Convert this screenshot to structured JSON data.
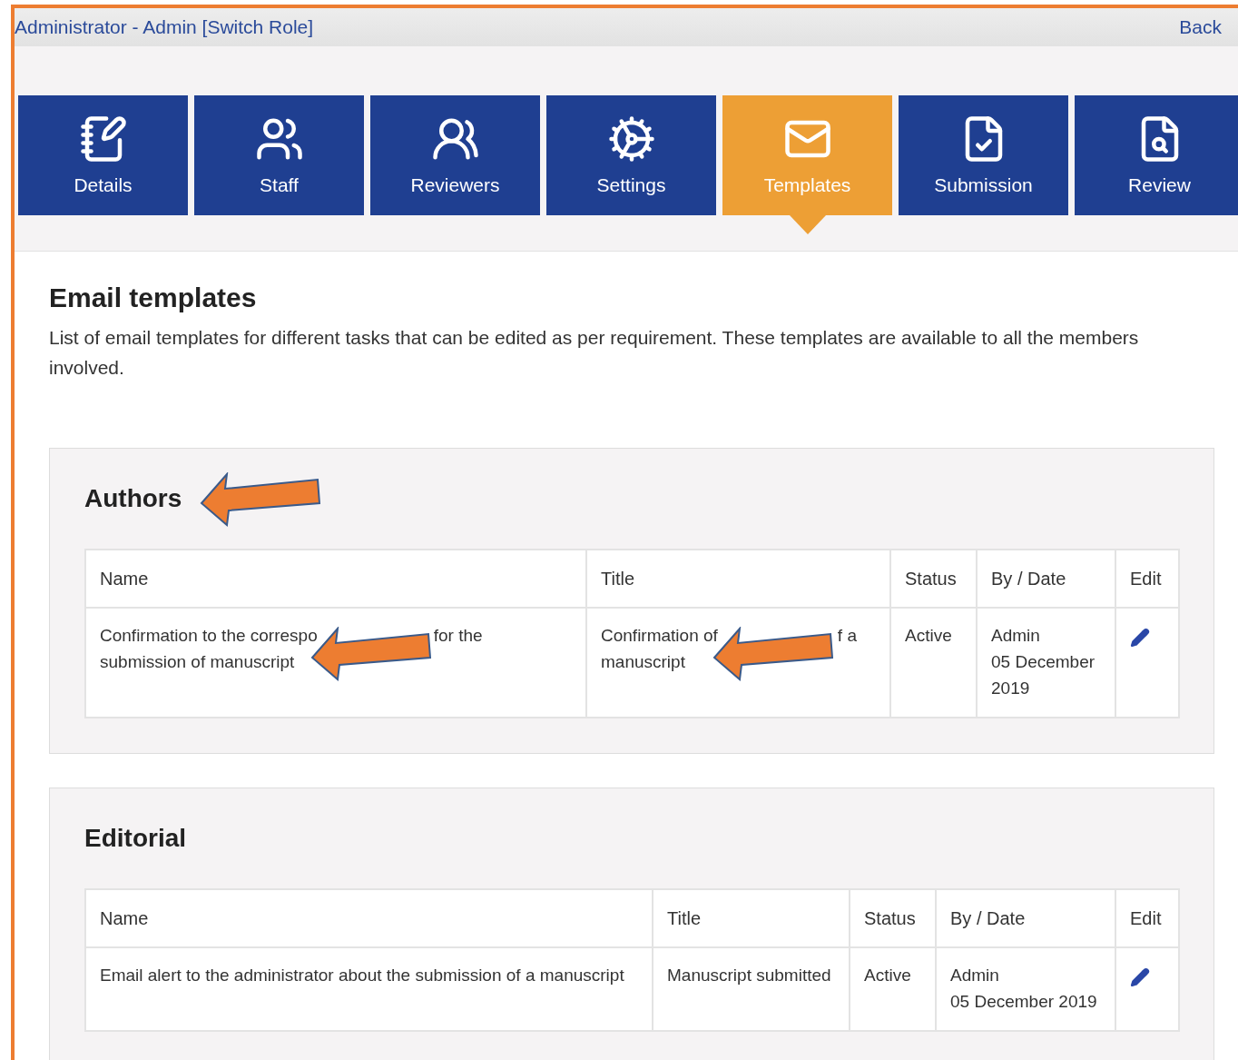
{
  "header": {
    "role_text": "Administrator - Admin [Switch Role]",
    "back_link": "Back"
  },
  "tabs": [
    {
      "label": "Details",
      "selected": false
    },
    {
      "label": "Staff",
      "selected": false
    },
    {
      "label": "Reviewers",
      "selected": false
    },
    {
      "label": "Settings",
      "selected": false
    },
    {
      "label": "Templates",
      "selected": true
    },
    {
      "label": "Submission",
      "selected": false
    },
    {
      "label": "Review",
      "selected": false
    }
  ],
  "page": {
    "title": "Email templates",
    "description": "List of email templates for different tasks that can be edited as per requirement. These templates are available to all the members involved."
  },
  "sections": [
    {
      "title": "Authors",
      "columns": [
        "Name",
        "Title",
        "Status",
        "By / Date",
        "Edit"
      ],
      "rows": [
        {
          "name_parts": [
            "Confirmation to the correspo",
            "for the",
            "submission of manuscript"
          ],
          "title_parts": [
            "Confirmation of",
            "f a",
            "manuscript"
          ],
          "status": "Active",
          "by": "Admin",
          "date": "05 December 2019"
        }
      ]
    },
    {
      "title": "Editorial",
      "columns": [
        "Name",
        "Title",
        "Status",
        "By / Date",
        "Edit"
      ],
      "rows": [
        {
          "name": "Email alert to the administrator about the submission of a manuscript",
          "title": "Manuscript submitted",
          "status": "Active",
          "by": "Admin",
          "date": "05 December 2019"
        }
      ]
    }
  ]
}
